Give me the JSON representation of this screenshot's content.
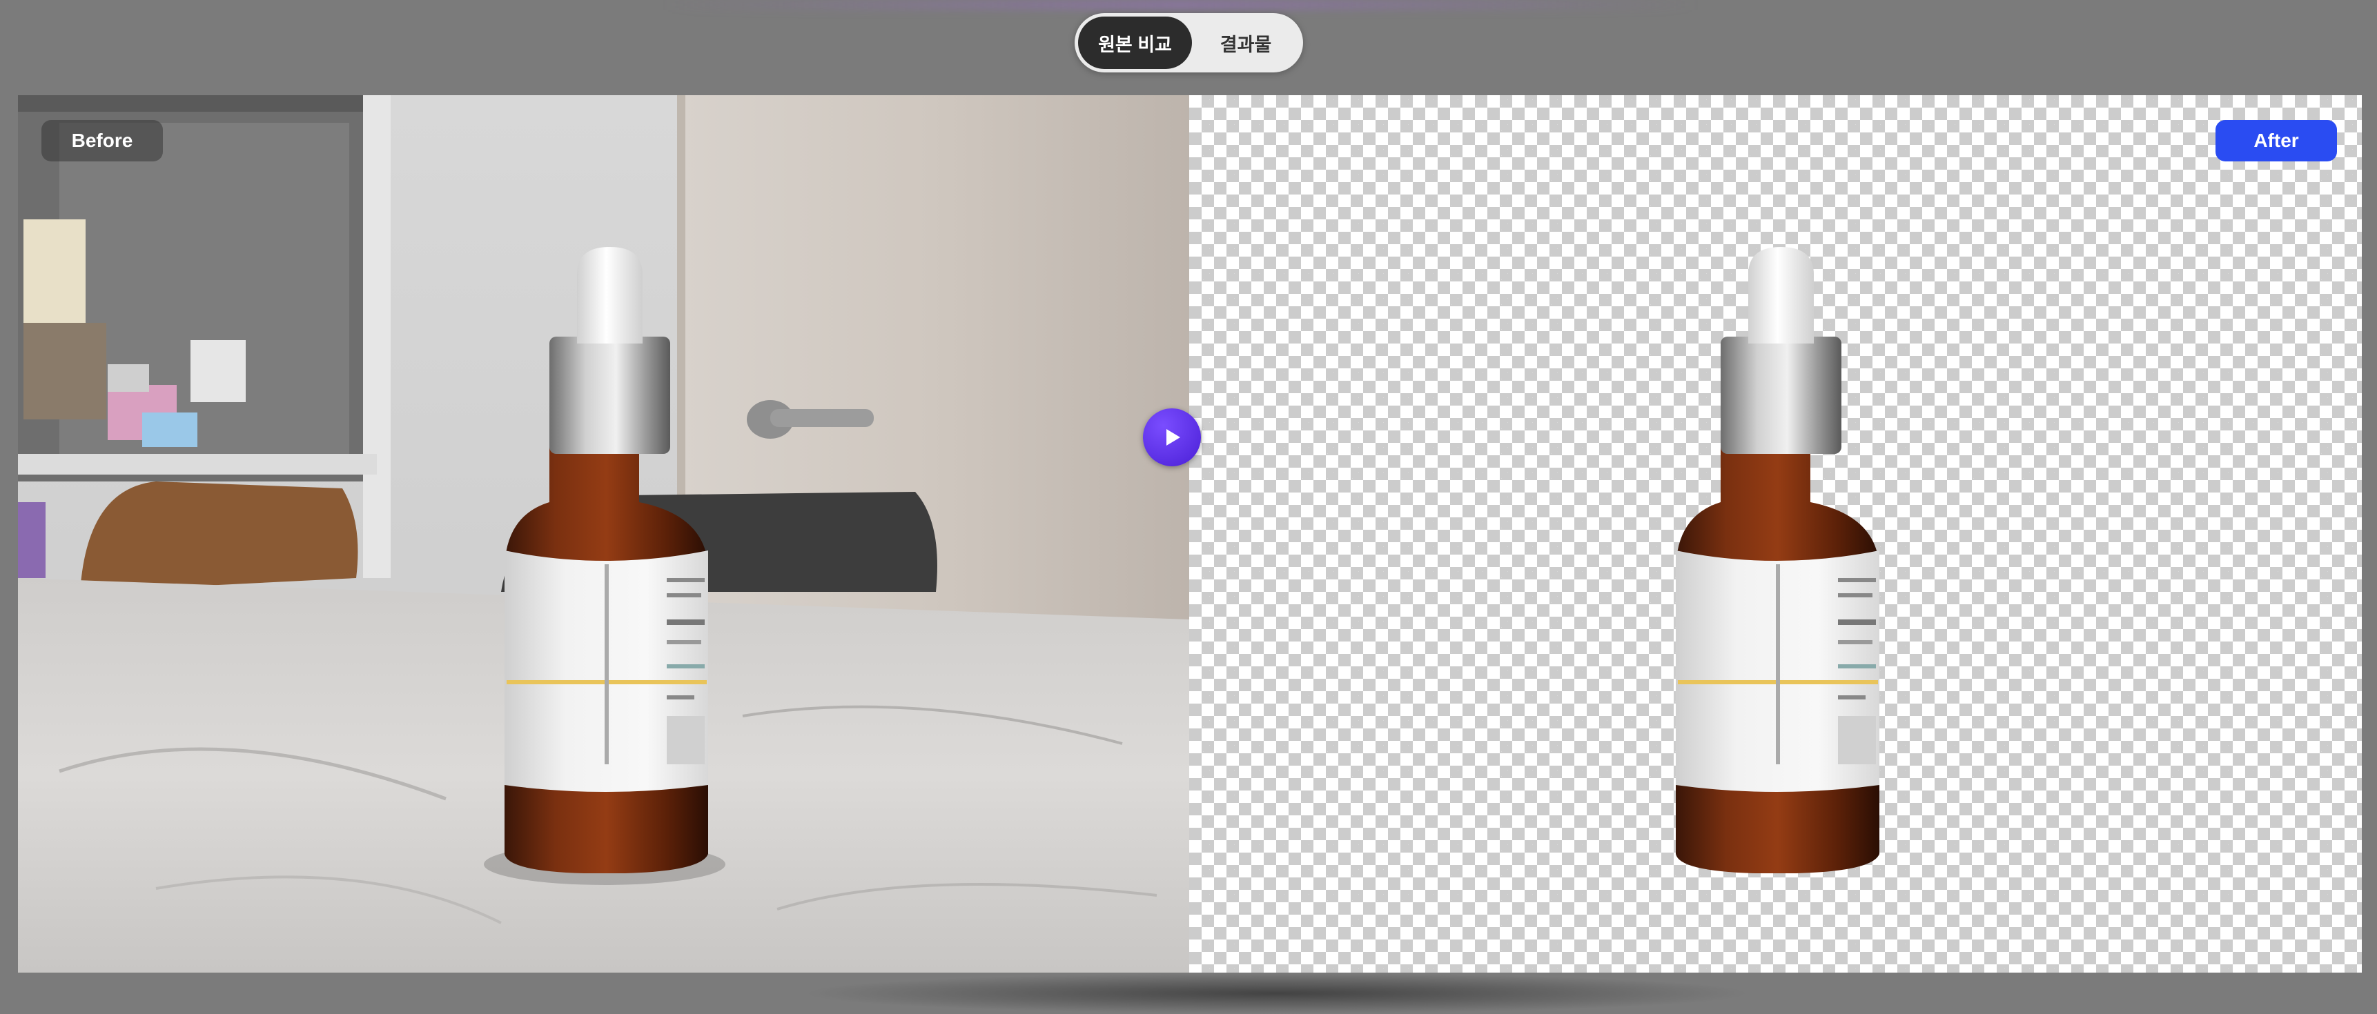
{
  "toggle": {
    "compare_label": "원본 비교",
    "result_label": "결과물",
    "selected": "원본 비교"
  },
  "comparison": {
    "before_label": "Before",
    "after_label": "After",
    "divider_position_percent": 50
  },
  "colors": {
    "background": "#7b7b7b",
    "toggle_active": "#2c2c2c",
    "after_badge": "#2a4cf2",
    "handle": "#5b2fe8"
  },
  "icons": {
    "handle_icon": "play-icon"
  }
}
